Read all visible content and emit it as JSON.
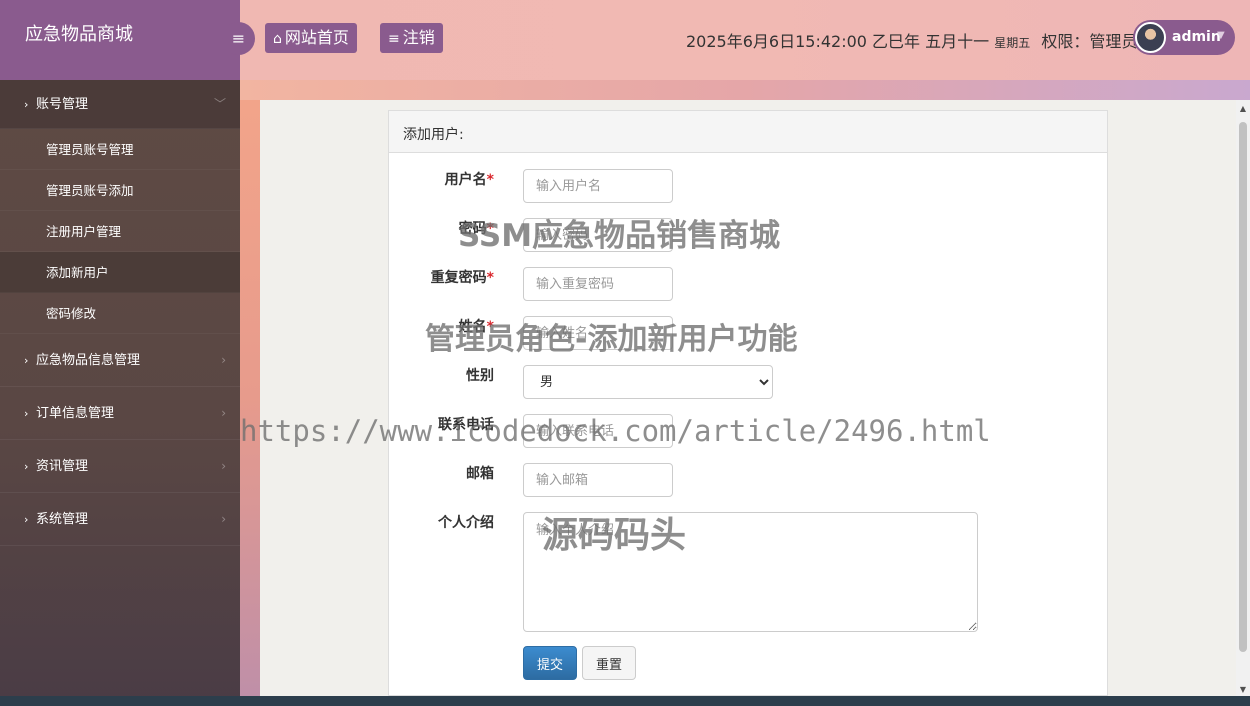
{
  "brand": {
    "title": "应急物品商城"
  },
  "header": {
    "home_label": "网站首页",
    "logout_label": "注销",
    "datetime": "2025年6月6日15:42:00 乙巳年 五月十一",
    "weekday": "星期五",
    "permission": "权限：管理员",
    "username": "admin"
  },
  "sidebar": {
    "groups": [
      {
        "label": "账号管理",
        "open": true,
        "items": [
          {
            "label": "管理员账号管理"
          },
          {
            "label": "管理员账号添加"
          },
          {
            "label": "注册用户管理"
          },
          {
            "label": "添加新用户",
            "active": true
          },
          {
            "label": "密码修改"
          }
        ]
      },
      {
        "label": "应急物品信息管理"
      },
      {
        "label": "订单信息管理"
      },
      {
        "label": "资讯管理"
      },
      {
        "label": "系统管理"
      }
    ]
  },
  "form": {
    "title": "添加用户:",
    "fields": {
      "username": {
        "label": "用户名",
        "placeholder": "输入用户名",
        "required": true
      },
      "password": {
        "label": "密码",
        "placeholder": "输入密码",
        "required": true
      },
      "repassword": {
        "label": "重复密码",
        "placeholder": "输入重复密码",
        "required": true
      },
      "name": {
        "label": "姓名",
        "placeholder": "输入姓名",
        "required": true
      },
      "gender": {
        "label": "性别",
        "selected": "男"
      },
      "phone": {
        "label": "联系电话",
        "placeholder": "输入联系电话"
      },
      "email": {
        "label": "邮箱",
        "placeholder": "输入邮箱"
      },
      "intro": {
        "label": "个人介绍",
        "placeholder": "输入个人介绍"
      }
    },
    "required_mark": "*",
    "submit_label": "提交",
    "reset_label": "重置"
  },
  "watermarks": {
    "line1": "SSM应急物品销售商城",
    "line2": "管理员角色-添加新用户功能",
    "line3": "https://www.icodedock.com/article/2496.html",
    "line4": "源码码头"
  },
  "colors": {
    "brand": "#8a5b8e",
    "primary": "#337ab7",
    "required": "#d9262c"
  },
  "icons": {
    "menu": "bars-icon",
    "home": "home-icon",
    "logout": "list-icon"
  }
}
